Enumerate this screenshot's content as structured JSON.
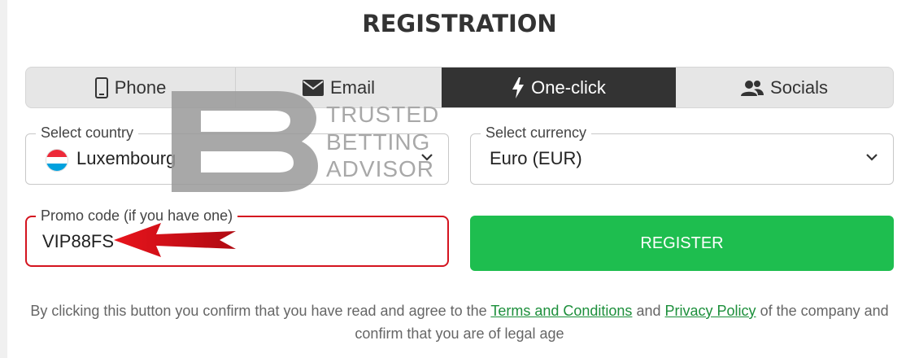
{
  "title": "REGISTRATION",
  "tabs": [
    {
      "label": "Phone",
      "icon": "phone-icon",
      "active": false
    },
    {
      "label": "Email",
      "icon": "envelope-icon",
      "active": false
    },
    {
      "label": "One-click",
      "icon": "lightning-icon",
      "active": true
    },
    {
      "label": "Socials",
      "icon": "users-icon",
      "active": false
    }
  ],
  "country": {
    "legend": "Select country",
    "value": "Luxembourg",
    "flag_colors": [
      "#ed2939",
      "#ffffff",
      "#00a1de"
    ]
  },
  "currency": {
    "legend": "Select currency",
    "value": "Euro (EUR)"
  },
  "promo": {
    "legend": "Promo code (if you have one)",
    "value": "VIP88FS"
  },
  "register_label": "REGISTER",
  "legal": {
    "prefix": "By clicking this button you confirm that you have read and agree to the",
    "terms": "Terms and Conditions",
    "and": "and",
    "privacy": "Privacy Policy",
    "suffix": "of the company and confirm that you are of legal age"
  },
  "watermark": {
    "line1": "TRUSTED",
    "line2": "BETTING",
    "line3": "ADVISOR"
  },
  "colors": {
    "accent_green": "#1ebe4f",
    "promo_border": "#d4141f",
    "active_tab": "#333333",
    "link": "#1c8f3b"
  }
}
